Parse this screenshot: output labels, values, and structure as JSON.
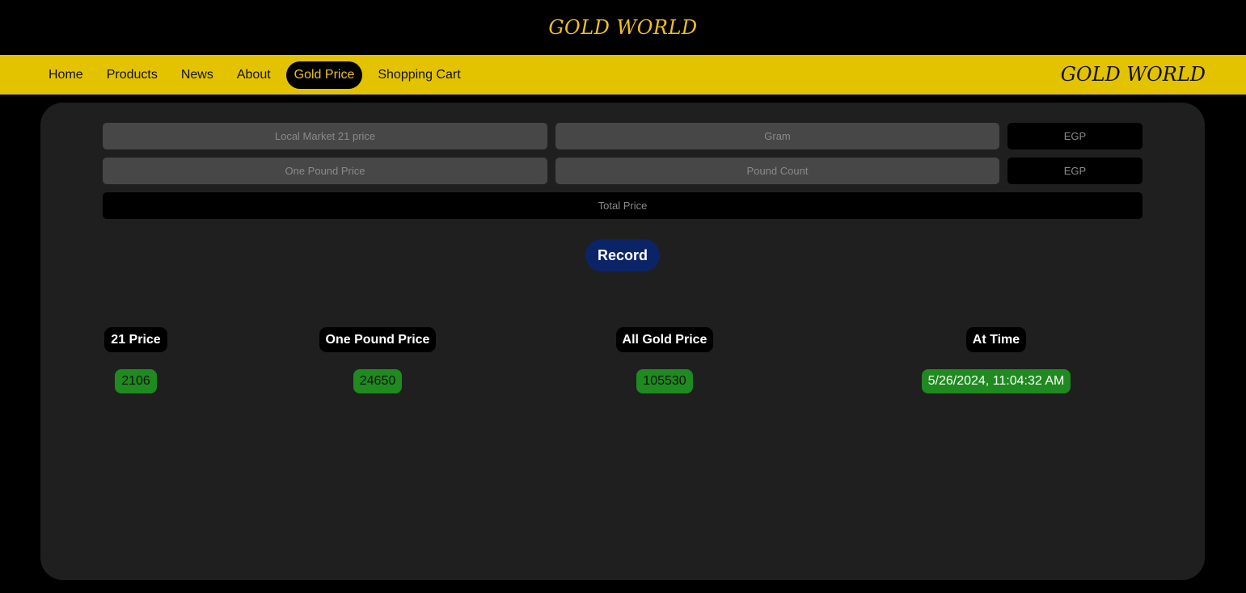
{
  "header": {
    "title": "GOLD WORLD"
  },
  "nav": {
    "items": [
      "Home",
      "Products",
      "News",
      "About",
      "Gold Price",
      "Shopping Cart"
    ],
    "active": "Gold Price",
    "brand": "GOLD WORLD"
  },
  "form": {
    "local_market_placeholder": "Local Market 21 price",
    "gram_placeholder": "Gram",
    "egp_1_placeholder": "EGP",
    "one_pound_placeholder": "One Pound Price",
    "pound_count_placeholder": "Pound Count",
    "egp_2_placeholder": "EGP",
    "total_price_placeholder": "Total Price"
  },
  "record_button": "Record",
  "results": {
    "headers": [
      "21 Price",
      "One Pound Price",
      "All Gold Price",
      "At Time"
    ],
    "values": [
      "2106",
      "24650",
      "105530",
      "5/26/2024, 11:04:32 AM"
    ]
  },
  "colors": {
    "gold": "#e3c300",
    "title_gold": "#f0c020",
    "record_blue": "#0b2468",
    "value_green": "#1f8a1f",
    "panel": "#1f1f1f"
  }
}
